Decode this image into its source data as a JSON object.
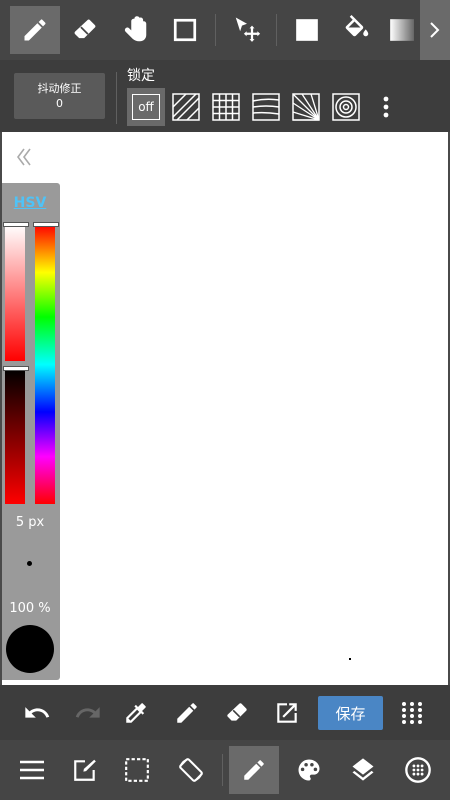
{
  "top_toolbar": {
    "tools": [
      "pen-icon",
      "eraser-icon",
      "hand-icon",
      "rectangle-icon",
      "move-icon",
      "fill-square-icon",
      "bucket-icon",
      "gradient-icon"
    ],
    "active_tool": "pen-icon"
  },
  "sub_toolbar": {
    "stabilizer_label": "抖动修正",
    "stabilizer_value": "0",
    "lock_label": "锁定",
    "rulers": [
      {
        "name": "ruler-off",
        "label": "off",
        "active": true
      },
      {
        "name": "ruler-parallel-diagonal",
        "active": false
      },
      {
        "name": "ruler-grid",
        "active": false
      },
      {
        "name": "ruler-perspective-horizontal",
        "active": false
      },
      {
        "name": "ruler-radial",
        "active": false
      },
      {
        "name": "ruler-concentric",
        "active": false
      }
    ]
  },
  "color_panel": {
    "mode_label": "HSV",
    "brush_size": "5 px",
    "opacity": "100 %",
    "current_color": "#000000"
  },
  "action_bar": {
    "buttons": [
      "undo-icon",
      "redo-icon",
      "eyedropper-icon",
      "pen-icon",
      "eraser-icon",
      "export-icon"
    ],
    "save_label": "保存",
    "more_icon": "grid-icon"
  },
  "nav_bar": {
    "buttons": [
      "menu-icon",
      "edit-icon",
      "selection-icon",
      "rotate-icon",
      "brush-icon",
      "palette-icon",
      "layers-icon",
      "material-icon"
    ],
    "active": "brush-icon"
  }
}
